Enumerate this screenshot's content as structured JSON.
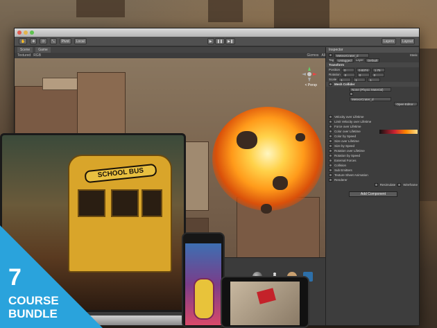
{
  "editor": {
    "toolbar": {
      "pivot": "Pivot",
      "local": "Local",
      "layers": "Layers",
      "layout": "Layout"
    },
    "scene_tabs": [
      "Scene",
      "Game"
    ],
    "scene_bar": {
      "shading": "Textured",
      "mode": "RGB",
      "gizmos": "Gizmos",
      "search": "All"
    },
    "gizmo_label": "< Persp",
    "inspector": {
      "tab": "Inspector",
      "object_name": "MeteorCrater_d",
      "static": "Static",
      "tag_label": "Tag",
      "tag_value": "Untagged",
      "layer_label": "Layer",
      "layer_value": "Default",
      "transform": "Transform",
      "position_label": "Position",
      "position": [
        "0",
        "0.8374",
        "1.75"
      ],
      "rotation_label": "Rotation",
      "rotation": [
        "0",
        "0",
        "0"
      ],
      "scale_label": "Scale",
      "scale": [
        "1",
        "1",
        "1"
      ],
      "collider": "Mesh Collider",
      "material_value": "None (Physic Material)",
      "mesh_value": "MeteorCrater_d",
      "open_editor": "Open Editor...",
      "particle_rows": [
        "Velocity over Lifetime",
        "Limit Velocity over Lifetime",
        "Force over Lifetime",
        "Color over Lifetime",
        "Color by Speed",
        "Size over Lifetime",
        "Size by Speed",
        "Rotation over Lifetime",
        "Rotation by Speed",
        "External Forces",
        "Collision",
        "Sub Emitters",
        "Texture Sheet Animation",
        "Renderer"
      ],
      "resimulate": "Resimulate",
      "wireframe": "Wireframe",
      "add_component": "Add Component"
    }
  },
  "laptop": {
    "bus_sign": "SCHOOL BUS"
  },
  "badge": {
    "number": "7",
    "line1": "COURSE",
    "line2": "BUNDLE",
    "color": "#2aa3dc"
  }
}
